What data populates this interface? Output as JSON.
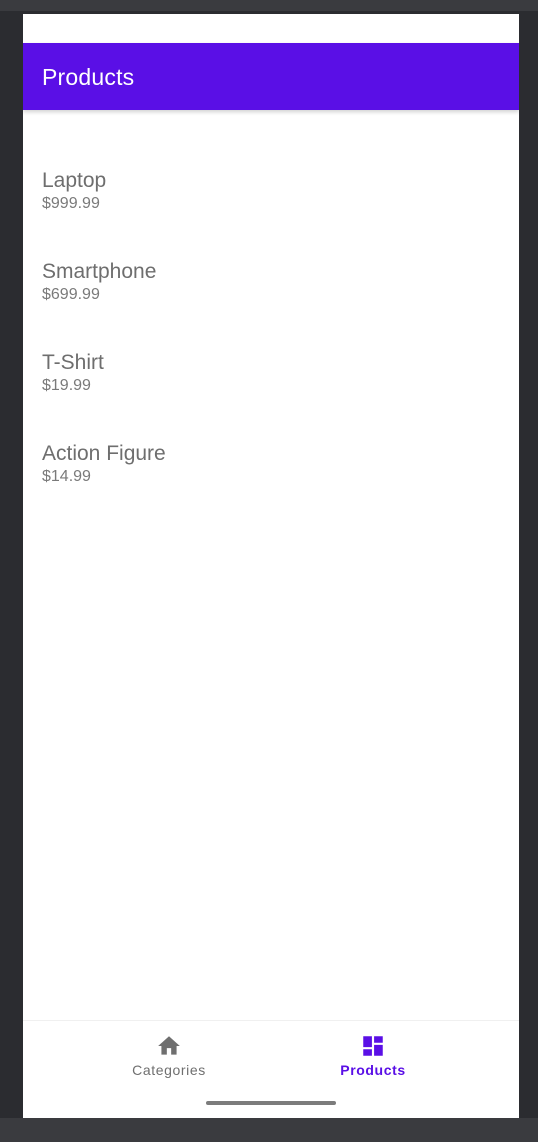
{
  "app_bar": {
    "title": "Products",
    "color": "#5a0fe6"
  },
  "products": [
    {
      "name": "Laptop",
      "price": "$999.99"
    },
    {
      "name": "Smartphone",
      "price": "$699.99"
    },
    {
      "name": "T-Shirt",
      "price": "$19.99"
    },
    {
      "name": "Action Figure",
      "price": "$14.99"
    }
  ],
  "bottom_nav": {
    "items": [
      {
        "label": "Categories",
        "icon": "home-icon",
        "selected": false
      },
      {
        "label": "Products",
        "icon": "dashboard-icon",
        "selected": true
      }
    ],
    "active_color": "#5a0fe6",
    "inactive_color": "#6f6f6f"
  }
}
